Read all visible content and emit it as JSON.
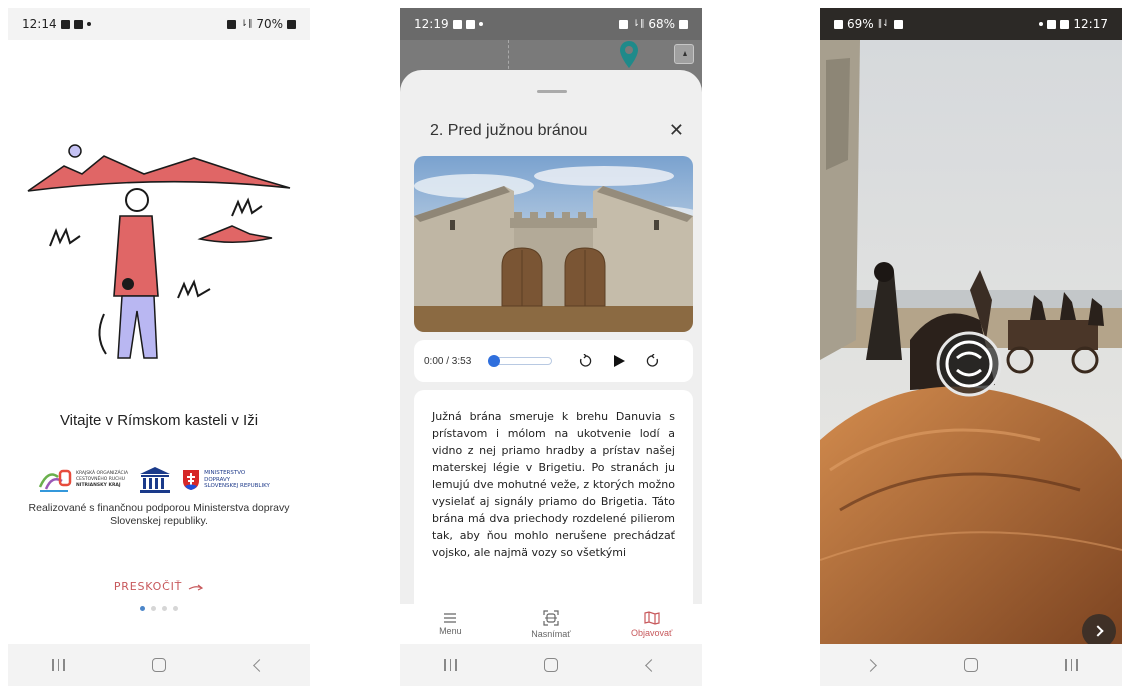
{
  "screens": [
    {
      "status": {
        "time": "12:14",
        "battery": "70%"
      },
      "welcome_title": "Vitajte v Rímskom kasteli v Iži",
      "logos": {
        "kocr": [
          "KRAJSKÁ ORGANIZÁCIA",
          "CESTOVNÉHO RUCHU",
          "NITRIANSKY KRAJ"
        ],
        "ministry": [
          "MINISTERSTVO",
          "DOPRAVY",
          "SLOVENSKEJ REPUBLIKY"
        ]
      },
      "credit": "Realizované s finančnou podporou Ministerstva dopravy Slovenskej republiky.",
      "skip_label": "PRESKOČIŤ",
      "pager": {
        "active_page": 1,
        "page_count": 4
      }
    },
    {
      "status": {
        "time": "12:19",
        "battery": "68%"
      },
      "title": "2. Pred južnou bránou",
      "player": {
        "time": "0:00 / 3:53",
        "progress": 0
      },
      "body": "Južná brána smeruje k brehu Danuvia s prístavom i mólom na ukotvenie lodí a vidno z nej priamo hradby a prístav našej materskej légie v Brigetiu. Po stranách ju lemujú dve mohutné veže, z ktorých možno vysielať aj signály priamo do Brigetia. Táto brána má dva priechody rozdelené pilierom tak, aby ňou mohlo nerušene prechádzať vojsko, ale najmä vozy so všetkými",
      "tabs": [
        {
          "label": "Menu",
          "icon": "menu-icon"
        },
        {
          "label": "Nasnímať",
          "icon": "scan-icon"
        },
        {
          "label": "Objavovať",
          "icon": "map-icon"
        }
      ],
      "active_tab": "Objavovať"
    },
    {
      "status": {
        "time": "12:17",
        "battery": "69%"
      },
      "overlay_icon": "ar-marker-icon",
      "next_icon": "chevron-right-icon"
    }
  ],
  "colors": {
    "accent": "#c7585b",
    "player_blue": "#2f6fdd",
    "pager_blue": "#4c86c9",
    "illustration_red": "#e06666",
    "trousers_lilac": "#b9b7f2"
  }
}
